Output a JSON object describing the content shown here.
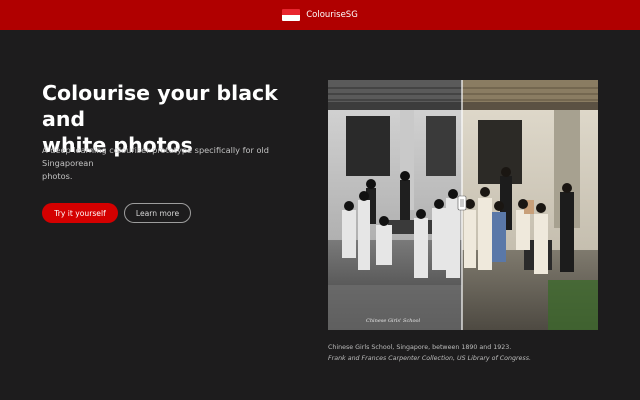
{
  "header": {
    "brand_name": "ColouriseSG",
    "flag_icon": "singapore-flag-icon",
    "colors": {
      "bar": "#b00000",
      "flag_red": "#e8262f"
    }
  },
  "hero": {
    "headline_line1": "Colourise your black and",
    "headline_line2": "white photos",
    "description_line1": "A deep learning colouriser prototype specifically for old Singaporean",
    "description_line2": "photos.",
    "primary_button": "Try it yourself",
    "secondary_button": "Learn more"
  },
  "photo": {
    "caption_line1": "Chinese Girls School, Singapore, between 1890 and 1923.",
    "caption_line2": "Frank and Frances Carpenter Collection, US Library of Congress.",
    "divider_handle": "compare-slider-handle",
    "watermark": "Chinese Girls' School"
  },
  "colors": {
    "background": "#1d1c1d",
    "accent": "#d40000"
  }
}
